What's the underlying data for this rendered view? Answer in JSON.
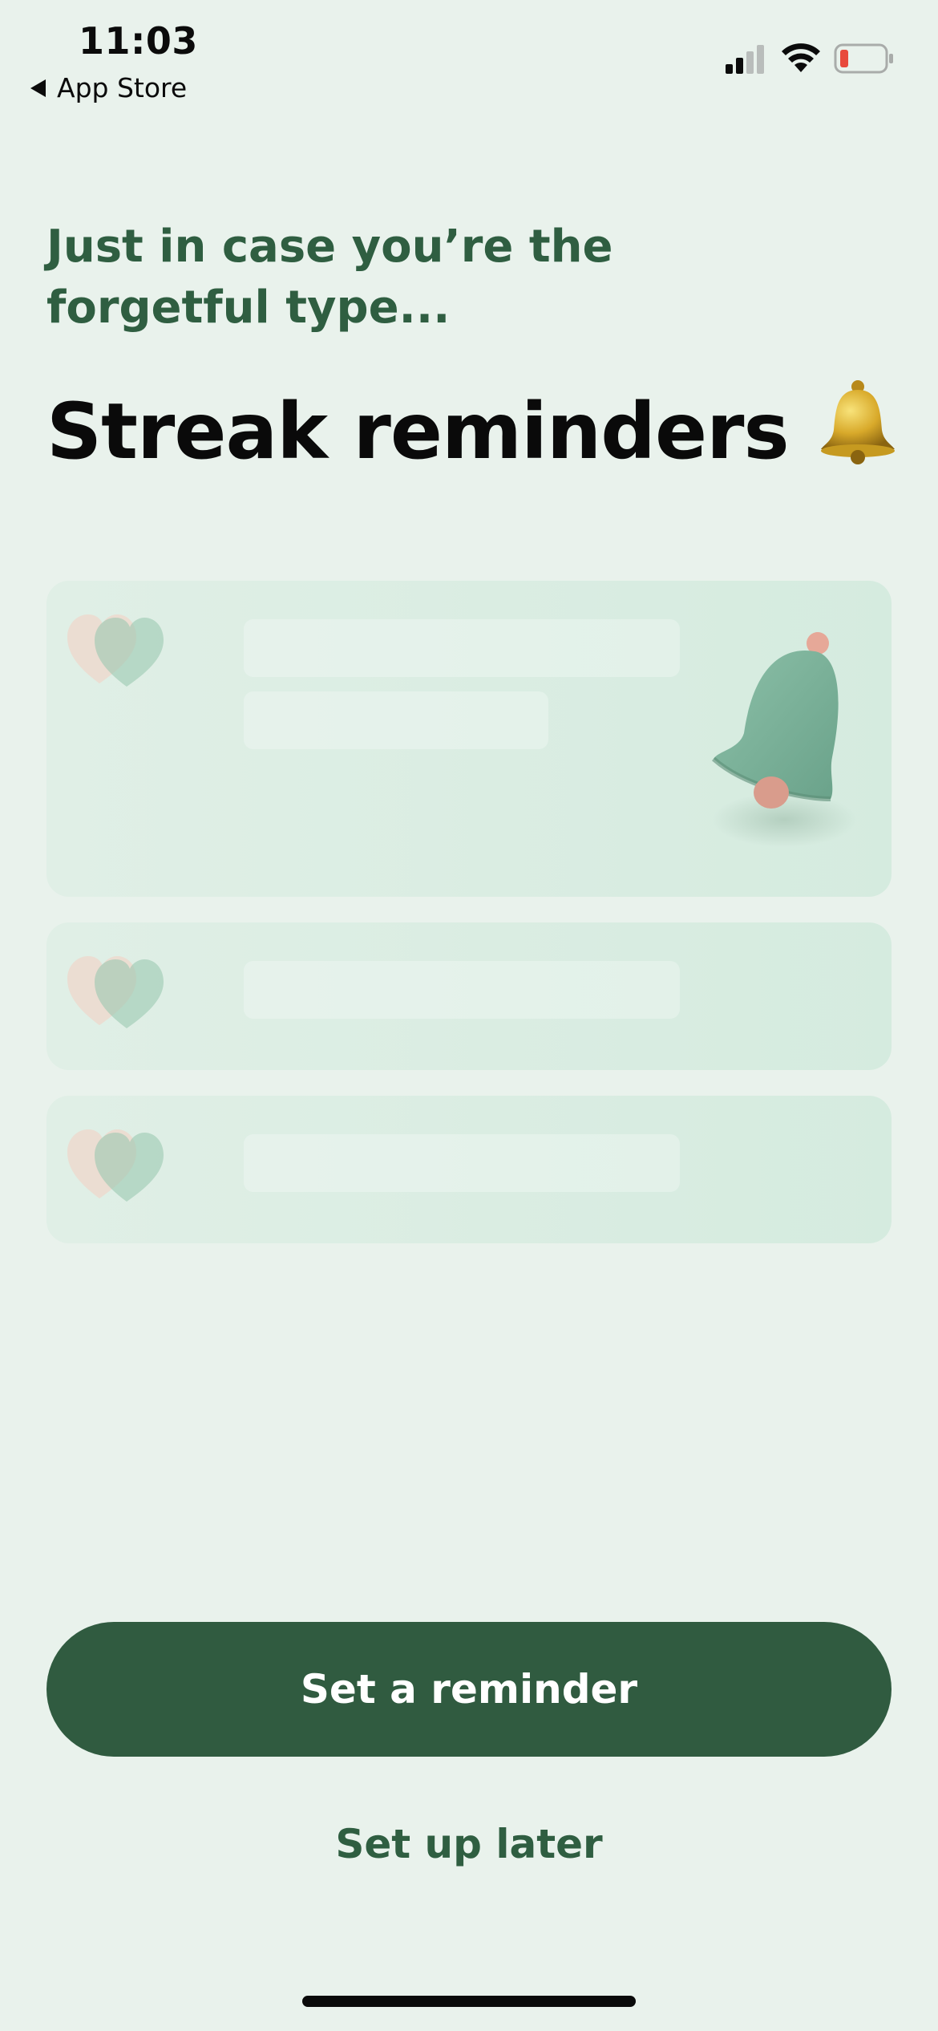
{
  "status_bar": {
    "time": "11:03",
    "back_label": "App Store",
    "icons": [
      "signal-icon",
      "wifi-icon",
      "battery-icon"
    ],
    "battery_color": "#e84a3c"
  },
  "header": {
    "subtitle_line1": "Just in case you’re the",
    "subtitle_line2": "forgetful type...",
    "title": "Streak reminders",
    "title_icon": "bell-emoji-icon"
  },
  "cards": [
    {
      "icon": "hearts-icon",
      "illustration": "bell-illustration"
    },
    {
      "icon": "hearts-icon"
    },
    {
      "icon": "hearts-icon"
    }
  ],
  "actions": {
    "primary_label": "Set a reminder",
    "secondary_label": "Set up later"
  },
  "colors": {
    "background": "#e9f2ec",
    "accent": "#305b40",
    "accent_text": "#2f5e41"
  }
}
